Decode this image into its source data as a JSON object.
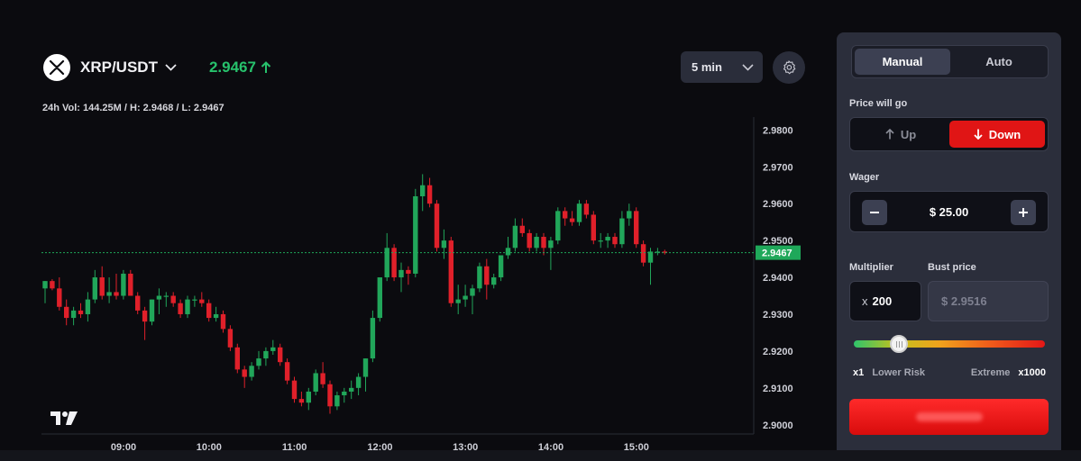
{
  "header": {
    "pair": "XRP/USDT",
    "price": "2.9467",
    "price_color": "#27c26c",
    "stats": "24h Vol: 144.25M / H: 2.9468 / L: 2.9467",
    "timeframe": "5 min",
    "icons": [
      "xrp-logo-icon",
      "chevron-down-icon",
      "arrow-up-icon",
      "gear-icon"
    ]
  },
  "panel": {
    "tabs": {
      "manual": "Manual",
      "auto": "Auto",
      "active": "Manual"
    },
    "direction_label": "Price will go",
    "up_label": "Up",
    "down_label": "Down",
    "direction_active": "Down",
    "wager_label": "Wager",
    "wager_value": "$ 25.00",
    "multiplier_label": "Multiplier",
    "multiplier_prefix": "x",
    "multiplier_value": "200",
    "bust_label": "Bust price",
    "bust_value": "$ 2.9516",
    "slider_min": "x1",
    "slider_min_text": "Lower Risk",
    "slider_max_text": "Extreme",
    "slider_max": "x1000",
    "slider_level": 0.2,
    "accent_red": "#e01515",
    "accent_green": "#27c26c"
  },
  "chart_data": {
    "type": "candlestick",
    "y_ticks": [
      "2.9800",
      "2.9700",
      "2.9600",
      "2.9500",
      "2.9400",
      "2.9300",
      "2.9200",
      "2.9100",
      "2.9000"
    ],
    "ylim": [
      2.8975,
      2.9835
    ],
    "x_ticks": [
      "09:00",
      "10:00",
      "11:00",
      "12:00",
      "13:00",
      "14:00",
      "15:00"
    ],
    "last_price": "2.9467",
    "up_color": "#21a65a",
    "down_color": "#e0202a",
    "candles": [
      [
        2.937,
        2.939,
        2.933,
        2.939
      ],
      [
        2.939,
        2.9395,
        2.9365,
        2.937
      ],
      [
        2.937,
        2.94,
        2.931,
        2.932
      ],
      [
        2.932,
        2.934,
        2.927,
        2.929
      ],
      [
        2.929,
        2.932,
        2.927,
        2.931
      ],
      [
        2.931,
        2.933,
        2.929,
        2.93
      ],
      [
        2.93,
        2.936,
        2.928,
        2.934
      ],
      [
        2.934,
        2.942,
        2.933,
        2.94
      ],
      [
        2.94,
        2.943,
        2.934,
        2.935
      ],
      [
        2.935,
        2.94,
        2.933,
        2.936
      ],
      [
        2.936,
        2.941,
        2.934,
        2.935
      ],
      [
        2.935,
        2.942,
        2.934,
        2.941
      ],
      [
        2.941,
        2.942,
        2.935,
        2.935
      ],
      [
        2.935,
        2.936,
        2.93,
        2.931
      ],
      [
        2.931,
        2.932,
        2.923,
        2.928
      ],
      [
        2.928,
        2.934,
        2.927,
        2.934
      ],
      [
        2.934,
        2.937,
        2.93,
        2.935
      ],
      [
        2.935,
        2.936,
        2.932,
        2.935
      ],
      [
        2.935,
        2.936,
        2.932,
        2.933
      ],
      [
        2.933,
        2.934,
        2.929,
        2.93
      ],
      [
        2.93,
        2.935,
        2.929,
        2.934
      ],
      [
        2.934,
        2.935,
        2.932,
        2.934
      ],
      [
        2.934,
        2.936,
        2.932,
        2.933
      ],
      [
        2.933,
        2.934,
        2.928,
        2.929
      ],
      [
        2.929,
        2.932,
        2.928,
        2.93
      ],
      [
        2.93,
        2.931,
        2.925,
        2.926
      ],
      [
        2.926,
        2.927,
        2.92,
        2.921
      ],
      [
        2.921,
        2.922,
        2.914,
        2.915
      ],
      [
        2.915,
        2.916,
        2.91,
        2.913
      ],
      [
        2.913,
        2.917,
        2.912,
        2.916
      ],
      [
        2.916,
        2.92,
        2.915,
        2.918
      ],
      [
        2.918,
        2.921,
        2.916,
        2.92
      ],
      [
        2.92,
        2.923,
        2.919,
        2.921
      ],
      [
        2.921,
        2.922,
        2.916,
        2.917
      ],
      [
        2.917,
        2.918,
        2.911,
        2.912
      ],
      [
        2.912,
        2.913,
        2.906,
        2.907
      ],
      [
        2.907,
        2.909,
        2.905,
        2.906
      ],
      [
        2.906,
        2.91,
        2.904,
        2.909
      ],
      [
        2.909,
        2.915,
        2.908,
        2.914
      ],
      [
        2.914,
        2.917,
        2.91,
        2.911
      ],
      [
        2.911,
        2.912,
        2.903,
        2.905
      ],
      [
        2.905,
        2.909,
        2.904,
        2.908
      ],
      [
        2.908,
        2.91,
        2.906,
        2.909
      ],
      [
        2.909,
        2.912,
        2.907,
        2.91
      ],
      [
        2.91,
        2.914,
        2.908,
        2.913
      ],
      [
        2.913,
        2.918,
        2.909,
        2.918
      ],
      [
        2.918,
        2.931,
        2.917,
        2.929
      ],
      [
        2.929,
        2.94,
        2.928,
        2.94
      ],
      [
        2.94,
        2.952,
        2.939,
        2.948
      ],
      [
        2.948,
        2.949,
        2.939,
        2.94
      ],
      [
        2.94,
        2.944,
        2.936,
        2.942
      ],
      [
        2.942,
        2.943,
        2.938,
        2.941
      ],
      [
        2.941,
        2.964,
        2.94,
        2.962
      ],
      [
        2.962,
        2.968,
        2.958,
        2.965
      ],
      [
        2.965,
        2.967,
        2.959,
        2.96
      ],
      [
        2.96,
        2.961,
        2.947,
        2.948
      ],
      [
        2.948,
        2.953,
        2.945,
        2.95
      ],
      [
        2.95,
        2.951,
        2.932,
        2.933
      ],
      [
        2.933,
        2.938,
        2.93,
        2.934
      ],
      [
        2.934,
        2.938,
        2.932,
        2.935
      ],
      [
        2.935,
        2.938,
        2.93,
        2.937
      ],
      [
        2.937,
        2.944,
        2.936,
        2.943
      ],
      [
        2.943,
        2.945,
        2.934,
        2.938
      ],
      [
        2.938,
        2.941,
        2.937,
        2.94
      ],
      [
        2.94,
        2.946,
        2.939,
        2.946
      ],
      [
        2.946,
        2.951,
        2.945,
        2.948
      ],
      [
        2.948,
        2.956,
        2.947,
        2.954
      ],
      [
        2.954,
        2.956,
        2.951,
        2.952
      ],
      [
        2.952,
        2.953,
        2.947,
        2.948
      ],
      [
        2.948,
        2.952,
        2.947,
        2.951
      ],
      [
        2.951,
        2.952,
        2.946,
        2.948
      ],
      [
        2.948,
        2.951,
        2.942,
        2.95
      ],
      [
        2.95,
        2.959,
        2.949,
        2.958
      ],
      [
        2.958,
        2.959,
        2.954,
        2.956
      ],
      [
        2.956,
        2.958,
        2.954,
        2.955
      ],
      [
        2.955,
        2.961,
        2.954,
        2.96
      ],
      [
        2.96,
        2.961,
        2.956,
        2.957
      ],
      [
        2.957,
        2.958,
        2.949,
        2.95
      ],
      [
        2.95,
        2.952,
        2.948,
        2.95
      ],
      [
        2.95,
        2.952,
        2.948,
        2.951
      ],
      [
        2.951,
        2.952,
        2.948,
        2.949
      ],
      [
        2.949,
        2.958,
        2.948,
        2.956
      ],
      [
        2.956,
        2.96,
        2.954,
        2.958
      ],
      [
        2.958,
        2.959,
        2.948,
        2.949
      ],
      [
        2.949,
        2.95,
        2.943,
        2.944
      ],
      [
        2.944,
        2.948,
        2.938,
        2.947
      ],
      [
        2.947,
        2.948,
        2.946,
        2.947
      ],
      [
        2.947,
        2.9475,
        2.9462,
        2.9467
      ]
    ]
  }
}
